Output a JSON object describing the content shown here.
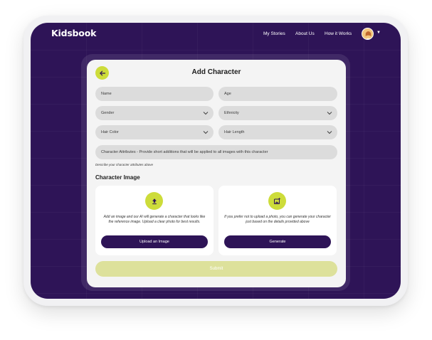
{
  "nav": {
    "logo": "Kidsbook",
    "links": [
      "My Stories",
      "About Us",
      "How it Works"
    ]
  },
  "card": {
    "title": "Add Character",
    "fields": {
      "name": "Name",
      "age": "Age",
      "gender": "Gender",
      "ethnicity": "Ethnicity",
      "hair_color": "Hair Color",
      "hair_length": "Hair Length",
      "attributes": "Character Attributes - Provide short additions that will be applied to all images with this character"
    },
    "attributes_hint": "Describe your character attributes above",
    "section_title": "Character Image",
    "upload": {
      "text": "Add an image and our AI will generate a character that looks like the reference image. Upload a clear photo for best results.",
      "button": "Upload an Image"
    },
    "generate": {
      "text": "If you prefer not to upload a photo, you can generate your character just based on the details provided above",
      "button": "Generate"
    },
    "submit": "Submit"
  },
  "colors": {
    "brand_purple": "#2e1457",
    "accent_lime": "#cddc3a",
    "submit_disabled": "#dde19b"
  },
  "icons": [
    "arrow-left-icon",
    "upload-icon",
    "sparkle-image-icon",
    "chevron-down-icon"
  ]
}
